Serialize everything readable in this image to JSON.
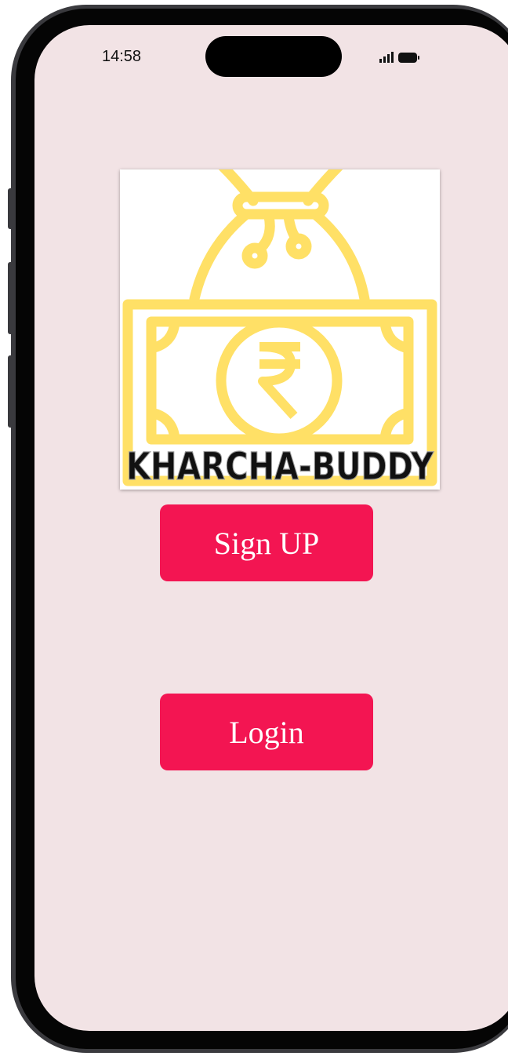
{
  "status_bar": {
    "time": "14:58",
    "signal_icon": "cellular-signal-icon",
    "battery_icon": "battery-icon"
  },
  "logo": {
    "brand_text": "KHARCHA-BUDDY",
    "icon": "money-bag-rupee-icon",
    "icon_color": "#ffe066",
    "text_color": "#111111"
  },
  "actions": {
    "signup_label": "Sign UP",
    "login_label": "Login",
    "button_color": "#f31552"
  },
  "theme": {
    "screen_background": "#f2e3e5"
  }
}
